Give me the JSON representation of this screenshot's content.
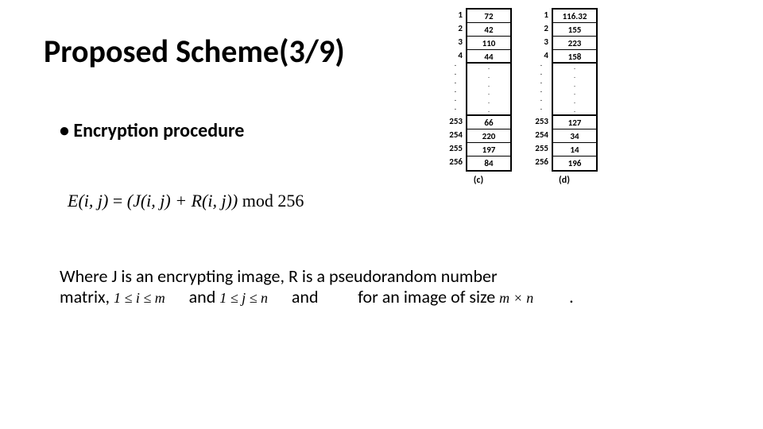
{
  "title": "Proposed Scheme(3/9)",
  "bullet_heading": "Encryption procedure",
  "equation": {
    "lhs": "E(i, j)",
    "rhs1": "(J(i, j) + R(i, j))",
    "op": "mod",
    "modval": "256"
  },
  "paragraph": {
    "p1": "Where J is an encrypting image, R is a pseudorandom number",
    "p2a": "matrix,",
    "cond1": "1 ≤ i ≤ m",
    "p2b": "and",
    "cond2": "1 ≤ j ≤ n",
    "p2c": "and",
    "p2d": "for an image of size",
    "size": "m × n",
    "p2e": "."
  },
  "table_c": {
    "caption": "(c)",
    "rows_top": [
      {
        "idx": "1",
        "val": "72"
      },
      {
        "idx": "2",
        "val": "42"
      },
      {
        "idx": "3",
        "val": "110"
      },
      {
        "idx": "4",
        "val": "44"
      }
    ],
    "rows_bottom": [
      {
        "idx": "253",
        "val": "66"
      },
      {
        "idx": "254",
        "val": "220"
      },
      {
        "idx": "255",
        "val": "197"
      },
      {
        "idx": "256",
        "val": "84"
      }
    ]
  },
  "table_d": {
    "caption": "(d)",
    "rows_top": [
      {
        "idx": "1",
        "val": "116.32"
      },
      {
        "idx": "2",
        "val": "155"
      },
      {
        "idx": "3",
        "val": "223"
      },
      {
        "idx": "4",
        "val": "158"
      }
    ],
    "rows_bottom": [
      {
        "idx": "253",
        "val": "127"
      },
      {
        "idx": "254",
        "val": "34"
      },
      {
        "idx": "255",
        "val": "14"
      },
      {
        "idx": "256",
        "val": "196"
      }
    ]
  }
}
